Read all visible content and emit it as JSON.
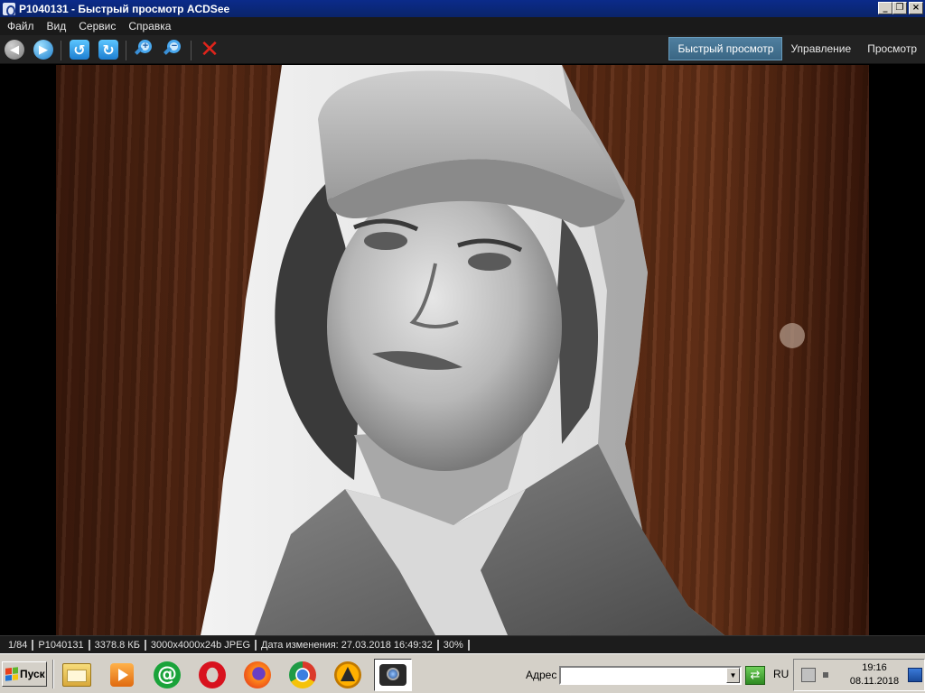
{
  "window": {
    "title": "P1040131 - Быстрый просмотр ACDSee",
    "controls": {
      "minimize": "_",
      "maximize": "❐",
      "close": "×"
    }
  },
  "menu": [
    "Файл",
    "Вид",
    "Сервис",
    "Справка"
  ],
  "toolbar": {
    "modes": [
      "Быстрый просмотр",
      "Управление",
      "Просмотр"
    ],
    "active_mode": "Быстрый просмотр",
    "icons": [
      "back-icon",
      "forward-icon",
      "rotate-left-icon",
      "rotate-right-icon",
      "zoom-in-icon",
      "zoom-out-icon",
      "delete-icon"
    ]
  },
  "status": {
    "position": "1/84",
    "filename": "P1040131",
    "filesize": "3378.8 КБ",
    "dimensions": "3000x4000x24b JPEG",
    "modified": "Дата изменения: 27.03.2018 16:49:32",
    "zoom": "30%"
  },
  "taskbar": {
    "start_label": "Пуск",
    "address_label": "Адрес",
    "address_value": "",
    "language": "RU",
    "time": "19:16",
    "date": "08.11.2018",
    "apps": [
      "explorer-icon",
      "media-player-icon",
      "mail-agent-icon",
      "opera-icon",
      "firefox-icon",
      "chrome-icon",
      "aimp-icon",
      "acdsee-icon"
    ]
  },
  "colors": {
    "title_bar": "#0a246a",
    "active_mode": "#3a6684",
    "delete_red": "#e0241b",
    "wood": "#4a200e"
  }
}
